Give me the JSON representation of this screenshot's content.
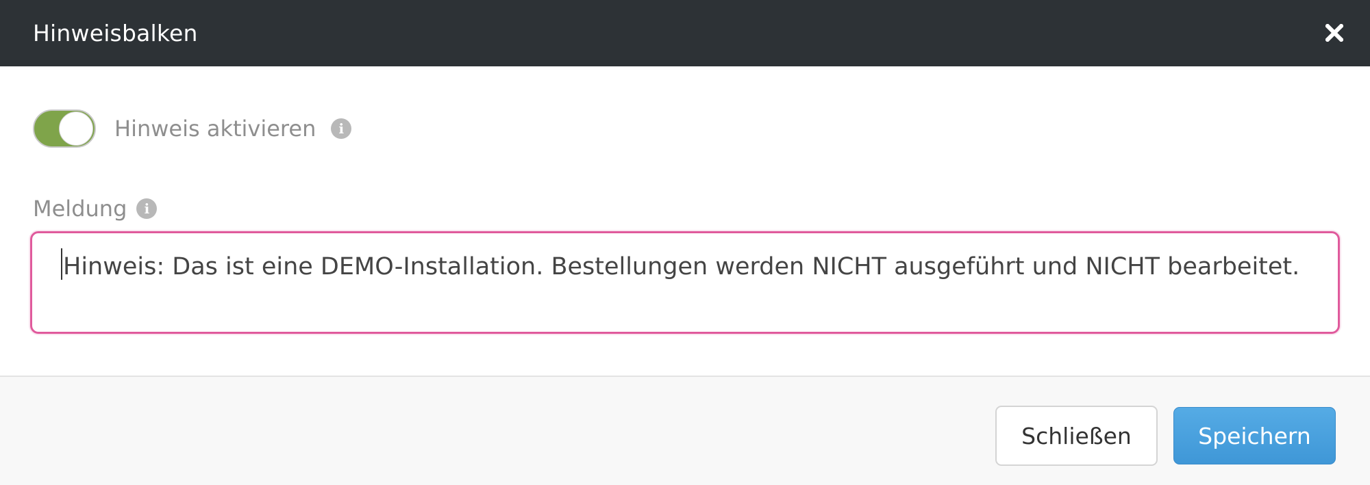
{
  "header": {
    "title": "Hinweisbalken",
    "close_icon": "close-icon"
  },
  "toggle": {
    "label": "Hinweis aktivieren",
    "state": "on",
    "on_color": "#7fa44a"
  },
  "message": {
    "label": "Meldung",
    "value": "Hinweis: Das ist eine DEMO-Installation. Bestellungen werden NICHT ausgeführt und NICHT bearbeitet.",
    "focus_color": "#e05a9c"
  },
  "footer": {
    "close_label": "Schließen",
    "save_label": "Speichern",
    "save_color": "#4aa3e0"
  }
}
